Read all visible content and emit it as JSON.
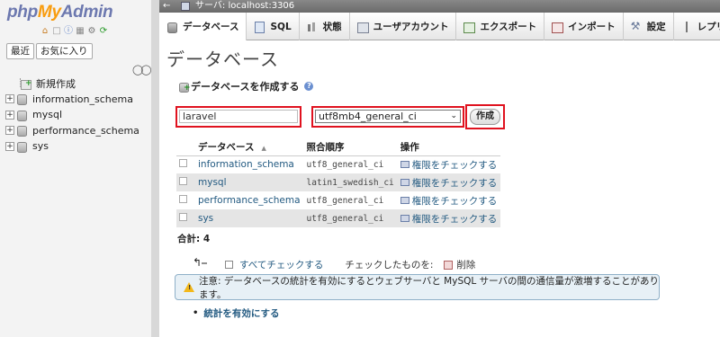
{
  "nav": {
    "logo": {
      "php": "php",
      "my": "My",
      "admin": "Admin"
    },
    "buttons": [
      "最近",
      "お気に入り"
    ],
    "tree": {
      "new_item": "新規作成",
      "databases": [
        "information_schema",
        "mysql",
        "performance_schema",
        "sys"
      ]
    }
  },
  "topbar": {
    "server": "サーバ: localhost:3306"
  },
  "tabs": [
    {
      "label": "データベース",
      "icon": "database-icon"
    },
    {
      "label": "SQL",
      "icon": "sql-icon"
    },
    {
      "label": "状態",
      "icon": "status-icon"
    },
    {
      "label": "ユーザアカウント",
      "icon": "users-icon"
    },
    {
      "label": "エクスポート",
      "icon": "export-icon"
    },
    {
      "label": "インポート",
      "icon": "import-icon"
    },
    {
      "label": "設定",
      "icon": "settings-icon"
    },
    {
      "label": "レプリケ",
      "icon": "replication-icon"
    }
  ],
  "page": {
    "title": "データベース",
    "create_header": "データベースを作成する",
    "db_name_value": "laravel",
    "collation_value": "utf8mb4_general_ci",
    "create_button": "作成",
    "highlight_color": "#e0121f"
  },
  "table": {
    "headers": {
      "database": "データベース",
      "collation": "照合順序",
      "action": "操作"
    },
    "rows": [
      {
        "name": "information_schema",
        "collation": "utf8_general_ci",
        "action": "権限をチェックする"
      },
      {
        "name": "mysql",
        "collation": "latin1_swedish_ci",
        "action": "権限をチェックする"
      },
      {
        "name": "performance_schema",
        "collation": "utf8_general_ci",
        "action": "権限をチェックする"
      },
      {
        "name": "sys",
        "collation": "utf8_general_ci",
        "action": "権限をチェックする"
      }
    ],
    "total": "合計: 4"
  },
  "bulk": {
    "check_all": "すべてチェックする",
    "with_selected": "チェックしたものを:",
    "delete": "削除"
  },
  "notice": {
    "text": "注意: データベースの統計を有効にするとウェブサーバと MySQL サーバの間の通信量が激増することがあります。"
  },
  "enable_stats": "統計を有効にする"
}
